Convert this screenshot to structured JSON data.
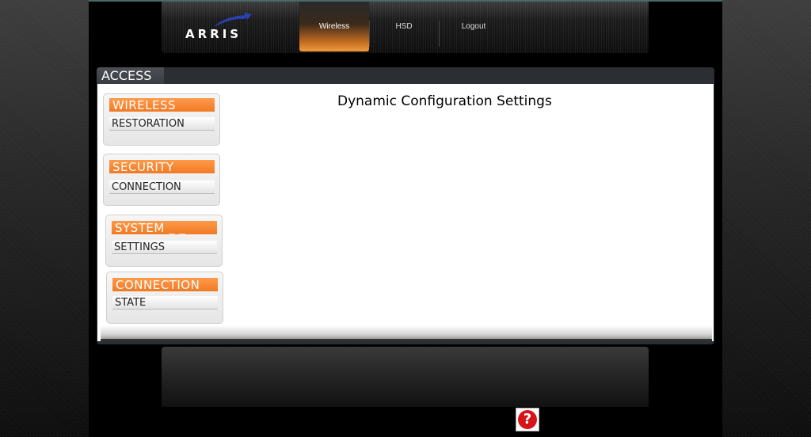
{
  "header": {
    "logo_text": "ARRIS",
    "nav": [
      {
        "label": "Wireless",
        "active": true
      },
      {
        "label": "HSD",
        "active": false
      },
      {
        "label": "Logout",
        "active": false
      }
    ]
  },
  "panel": {
    "tab_label": "ACCESS",
    "title": "Dynamic Configuration Settings"
  },
  "menu": [
    {
      "heading": "WIRELESS",
      "item": "RESTORATION"
    },
    {
      "heading": "SECURITY",
      "item": "CONNECTION"
    },
    {
      "heading": "SYSTEM _ _",
      "item": "SETTINGS"
    },
    {
      "heading": "CONNECTION",
      "item": "STATE"
    }
  ],
  "help": {
    "glyph": "?"
  },
  "colors": {
    "accent_orange": "#f07a24",
    "help_red": "#d8141b",
    "logo_swoosh": "#2c3fb0"
  }
}
